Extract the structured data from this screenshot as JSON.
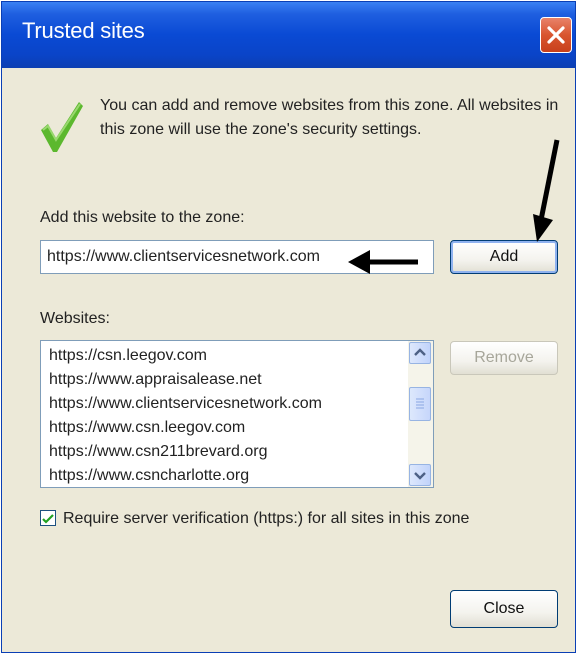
{
  "window": {
    "title": "Trusted sites"
  },
  "intro_text": "You can add and remove websites from this zone. All websites in this zone will use the zone's security settings.",
  "add_section": {
    "label": "Add this website to the zone:",
    "input_value": "https://www.clientservicesnetwork.com",
    "add_button": "Add"
  },
  "websites": {
    "label": "Websites:",
    "items": [
      "https://csn.leegov.com",
      "https://www.appraisalease.net",
      "https://www.clientservicesnetwork.com",
      "https://www.csn.leegov.com",
      "https://www.csn211brevard.org",
      "https://www.csncharlotte.org"
    ],
    "remove_button": "Remove"
  },
  "verification": {
    "checked": true,
    "label": "Require server verification (https:) for all sites in this zone"
  },
  "close_button": "Close",
  "colors": {
    "titlebar": "#0a4ad4",
    "dialog_bg": "#ece9d8",
    "close_red": "#d9552f",
    "check_green": "#5cb82e"
  }
}
